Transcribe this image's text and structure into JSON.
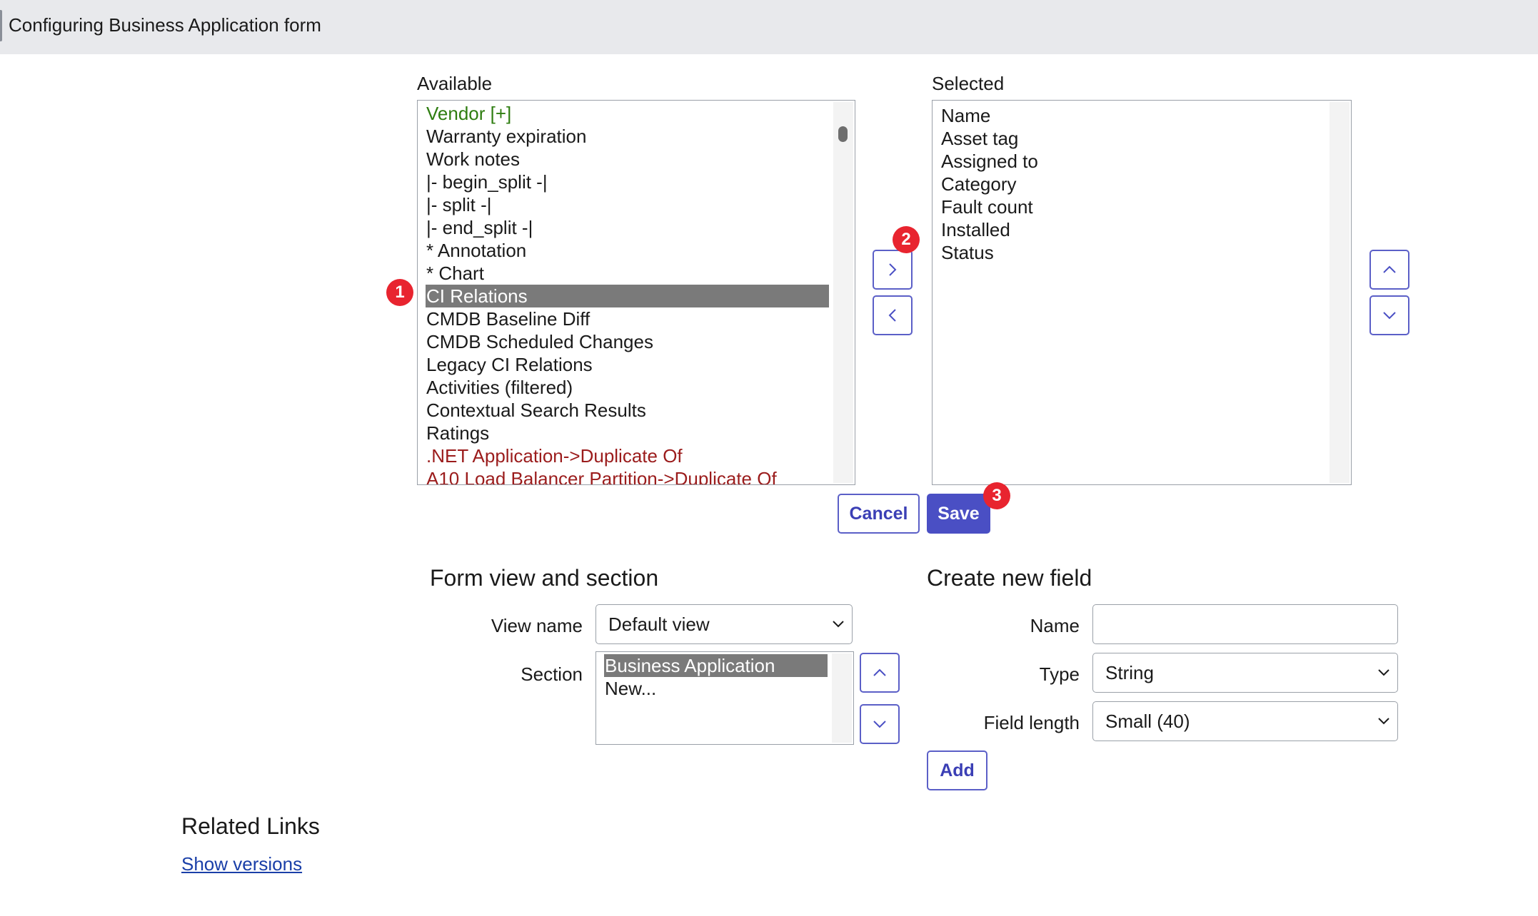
{
  "header": {
    "title": "Configuring Business Application form"
  },
  "available": {
    "label": "Available",
    "items": [
      {
        "text": "Vendor [+]",
        "style": "green"
      },
      {
        "text": "Warranty expiration",
        "style": ""
      },
      {
        "text": "Work notes",
        "style": ""
      },
      {
        "text": "|- begin_split -|",
        "style": ""
      },
      {
        "text": "|- split -|",
        "style": ""
      },
      {
        "text": "|- end_split -|",
        "style": ""
      },
      {
        "text": "* Annotation",
        "style": ""
      },
      {
        "text": "* Chart",
        "style": ""
      },
      {
        "text": "CI Relations",
        "style": "selected"
      },
      {
        "text": "CMDB Baseline Diff",
        "style": ""
      },
      {
        "text": "CMDB Scheduled Changes",
        "style": ""
      },
      {
        "text": "Legacy CI Relations",
        "style": ""
      },
      {
        "text": "Activities (filtered)",
        "style": ""
      },
      {
        "text": "Contextual Search Results",
        "style": ""
      },
      {
        "text": "Ratings",
        "style": ""
      },
      {
        "text": ".NET Application->Duplicate Of",
        "style": "red"
      },
      {
        "text": "A10 Load Balancer Partition->Duplicate Of",
        "style": "red"
      }
    ]
  },
  "selected": {
    "label": "Selected",
    "items": [
      "Name",
      "Asset tag",
      "Assigned to",
      "Category",
      "Fault count",
      "Installed",
      "Status"
    ]
  },
  "badges": {
    "one": "1",
    "two": "2",
    "three": "3"
  },
  "actions": {
    "cancel_label": "Cancel",
    "save_label": "Save"
  },
  "form_view": {
    "heading": "Form view and section",
    "view_name_label": "View name",
    "view_name_value": "Default view",
    "section_label": "Section",
    "sections": [
      {
        "text": "Business Application",
        "style": "selected"
      },
      {
        "text": "New...",
        "style": ""
      }
    ]
  },
  "new_field": {
    "heading": "Create new field",
    "name_label": "Name",
    "name_value": "",
    "type_label": "Type",
    "type_value": "String",
    "length_label": "Field length",
    "length_value": "Small (40)",
    "add_label": "Add"
  },
  "related": {
    "heading": "Related Links",
    "show_versions": "Show versions"
  },
  "colors": {
    "accent": "#4a4fc4",
    "badge": "#e8242f",
    "selected_row": "#7a7a7a",
    "green_item": "#2e7d10",
    "red_item": "#9b1c1c",
    "link": "#1a3fa8",
    "header_bg": "#e8e9ec"
  },
  "icons": {
    "move_right": "chevron-right-icon",
    "move_left": "chevron-left-icon",
    "move_up": "chevron-up-icon",
    "move_down": "chevron-down-icon"
  }
}
